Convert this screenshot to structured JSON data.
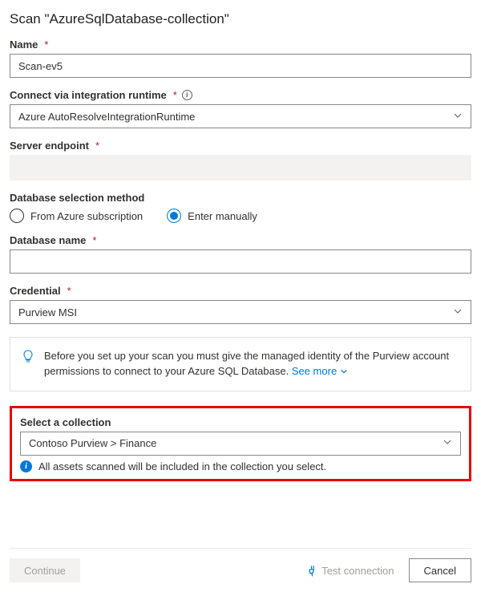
{
  "title": "Scan \"AzureSqlDatabase-collection\"",
  "fields": {
    "name": {
      "label": "Name",
      "value": "Scan-ev5"
    },
    "runtime": {
      "label": "Connect via integration runtime",
      "value": "Azure AutoResolveIntegrationRuntime"
    },
    "endpoint": {
      "label": "Server endpoint"
    },
    "selection_method": {
      "label": "Database selection method",
      "opt_subscription": "From Azure subscription",
      "opt_manual": "Enter manually",
      "selected": "manual"
    },
    "db_name": {
      "label": "Database name",
      "value": ""
    },
    "credential": {
      "label": "Credential",
      "value": "Purview MSI"
    },
    "collection": {
      "label": "Select a collection",
      "value": "Contoso Purview > Finance",
      "hint": "All assets scanned will be included in the collection you select."
    }
  },
  "message": {
    "text": "Before you set up your scan you must give the managed identity of the Purview account permissions to connect to your Azure SQL Database.",
    "see_more": "See more"
  },
  "footer": {
    "continue": "Continue",
    "test": "Test connection",
    "cancel": "Cancel"
  }
}
